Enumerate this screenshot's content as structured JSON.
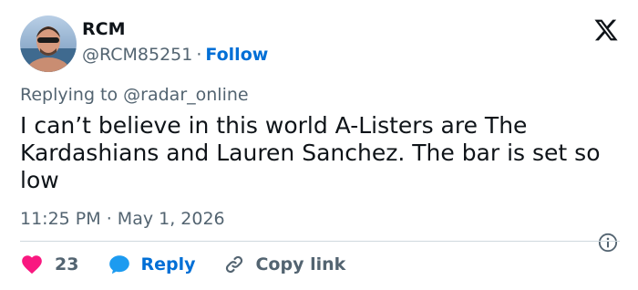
{
  "author": {
    "name": "RCM",
    "handle": "@RCM85251",
    "separator": "·",
    "follow_label": "Follow"
  },
  "tweet": {
    "replying_prefix": "Replying to",
    "replying_to": "@radar_online",
    "text": "I can’t believe in this world A-Listers are The Kardashians and Lauren Sanchez. The bar is set so low",
    "time": "11:25 PM",
    "date_separator": "·",
    "date": "May 1, 2026"
  },
  "actions": {
    "like_count": "23",
    "reply_label": "Reply",
    "copy_link_label": "Copy link"
  },
  "icons": {
    "logo": "x-logo-icon",
    "info": "info-icon",
    "like": "heart-icon",
    "reply": "speech-bubble-icon",
    "copy": "link-icon"
  },
  "colors": {
    "text": "#0f1419",
    "secondary": "#536471",
    "link": "#006fd6",
    "like": "#f91880",
    "reply_bubble": "#1d9bf0",
    "divider": "#cfd9de"
  }
}
